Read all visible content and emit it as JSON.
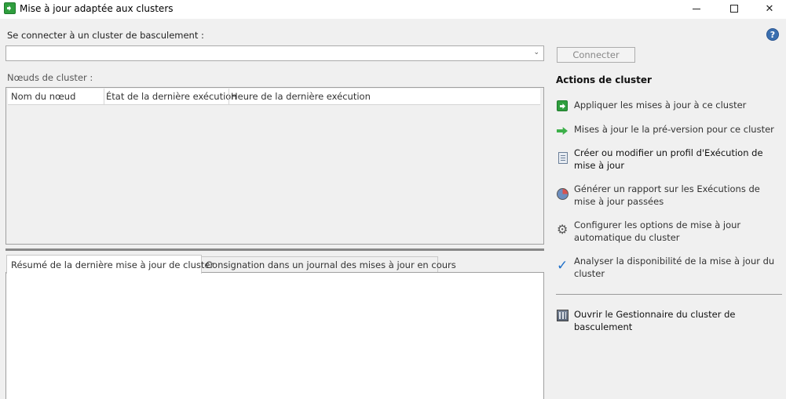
{
  "window": {
    "title": "Mise à jour adaptée aux clusters",
    "icon": "cluster-update-icon"
  },
  "connect": {
    "label": "Se connecter à un cluster de basculement :",
    "combo_value": "",
    "button_label": "Connecter"
  },
  "nodes": {
    "label": "Nœuds de cluster :",
    "columns": [
      "Nom du nœud",
      "État de la dernière exécution",
      "Heure de la dernière exécution"
    ]
  },
  "tabs": [
    {
      "label": "Résumé de la dernière mise à jour de cluster",
      "active": true
    },
    {
      "label": "Consignation dans un journal des mises à jour en cours",
      "active": false
    }
  ],
  "actions": {
    "title": "Actions de cluster",
    "items": [
      {
        "label": "Appliquer les mises à jour à ce cluster",
        "icon": "apply-updates-icon"
      },
      {
        "label": "Mises à jour le la pré-version pour ce cluster",
        "icon": "preview-updates-icon"
      },
      {
        "label": "Créer ou modifier un profil d'Exécution de mise à jour",
        "icon": "profile-document-icon"
      },
      {
        "label": "Générer un rapport sur les Exécutions de mise à jour passées",
        "icon": "report-icon"
      },
      {
        "label": "Configurer les options de mise à jour automatique du cluster",
        "icon": "gear-icon"
      },
      {
        "label": "Analyser la disponibilité de la mise à jour du cluster",
        "icon": "checkmark-icon"
      }
    ],
    "manager": {
      "label": "Ouvrir le Gestionnaire du cluster de basculement",
      "icon": "cluster-manager-icon"
    }
  },
  "help": {
    "glyph": "?"
  },
  "colors": {
    "accent_green": "#2f9e3e",
    "link_blue": "#1e6fc8"
  }
}
